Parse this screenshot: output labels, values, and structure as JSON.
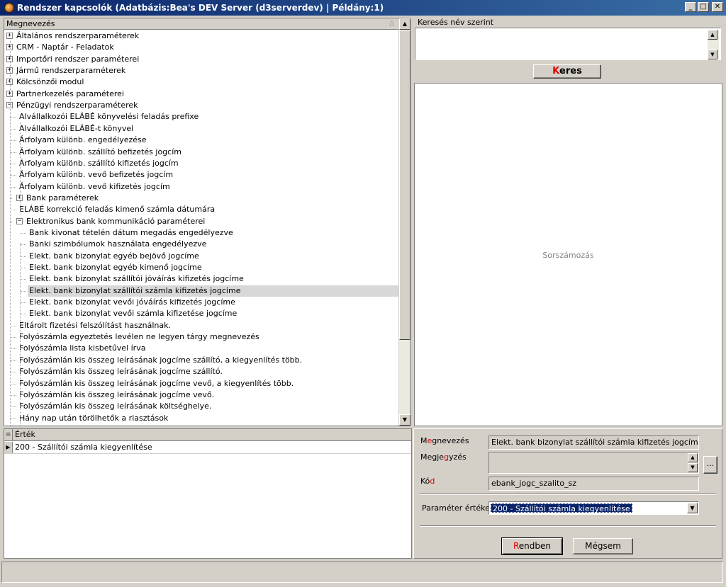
{
  "window": {
    "title": "Rendszer kapcsolók  (Adatbázis:Bea's DEV Server (d3serverdev) | Példány:1)",
    "minimize": "_",
    "maximize": "□",
    "close": "✕"
  },
  "tree": {
    "header": "Megnevezés",
    "rows": [
      {
        "label": "Általános rendszerparaméterek",
        "level": 0,
        "expander": "+"
      },
      {
        "label": "CRM - Naptár - Feladatok",
        "level": 0,
        "expander": "+"
      },
      {
        "label": "Importőri rendszer paraméterei",
        "level": 0,
        "expander": "+"
      },
      {
        "label": "Jármű rendszerparaméterek",
        "level": 0,
        "expander": "+"
      },
      {
        "label": "Kölcsönzői modul",
        "level": 0,
        "expander": "+"
      },
      {
        "label": "Partnerkezelés paraméterei",
        "level": 0,
        "expander": "+"
      },
      {
        "label": "Pénzügyi rendszerparaméterek",
        "level": 0,
        "expander": "−"
      },
      {
        "label": "Alvállalkozói ELÁBÉ könyvelési feladás prefixe",
        "level": 1
      },
      {
        "label": "Alvállalkozói ELÁBÉ-t könyvel",
        "level": 1
      },
      {
        "label": "Árfolyam különb. engedélyezése",
        "level": 1
      },
      {
        "label": "Árfolyam különb. szállító befizetés jogcím",
        "level": 1
      },
      {
        "label": "Árfolyam különb. szállító kifizetés jogcím",
        "level": 1
      },
      {
        "label": "Árfolyam különb. vevő befizetés jogcím",
        "level": 1
      },
      {
        "label": "Árfolyam különb. vevő kifizetés jogcím",
        "level": 1
      },
      {
        "label": "Bank paraméterek",
        "level": 1,
        "expander": "+"
      },
      {
        "label": "ELÁBÉ korrekció feladás kimenő számla dátumára",
        "level": 1
      },
      {
        "label": "Elektronikus bank kommunikáció paraméterei",
        "level": 1,
        "expander": "−"
      },
      {
        "label": "Bank kivonat tételén dátum megadás engedélyezve",
        "level": 2
      },
      {
        "label": "Banki szimbólumok használata engedélyezve",
        "level": 2
      },
      {
        "label": "Elekt. bank bizonylat egyéb bejövő jogcíme",
        "level": 2
      },
      {
        "label": "Elekt. bank bizonylat egyéb kimenő jogcíme",
        "level": 2
      },
      {
        "label": "Elekt. bank bizonylat szállítói jóváírás kifizetés jogcíme",
        "level": 2
      },
      {
        "label": "Elekt. bank bizonylat szállítói számla kifizetés jogcíme",
        "level": 2,
        "selected": true
      },
      {
        "label": "Elekt. bank bizonylat vevői jóváírás kifizetés jogcíme",
        "level": 2
      },
      {
        "label": "Elekt. bank bizonylat vevői számla kifizetése jogcíme",
        "level": 2
      },
      {
        "label": "Eltárolt fizetési felszólítást használnak.",
        "level": 1
      },
      {
        "label": "Folyószámla egyeztetés levélen ne legyen tárgy megnevezés",
        "level": 1
      },
      {
        "label": "Folyószámla lista kisbetűvel írva",
        "level": 1
      },
      {
        "label": "Folyószámlán kis összeg leírásának jogcíme szállító, a kiegyenlítés több.",
        "level": 1
      },
      {
        "label": "Folyószámlán kis összeg leírásának jogcíme szállító.",
        "level": 1
      },
      {
        "label": "Folyószámlán kis összeg leírásának jogcíme vevő, a kiegyenlítés több.",
        "level": 1
      },
      {
        "label": "Folyószámlán kis összeg leírásának jogcíme vevő.",
        "level": 1
      },
      {
        "label": "Folyószámlán kis összeg leírásának költséghelye.",
        "level": 1
      },
      {
        "label": "Hány nap után törölhetők a riasztások",
        "level": 1
      }
    ]
  },
  "values": {
    "header": "Érték",
    "rows": [
      "200 - Szállítói számla kiegyenlítése"
    ]
  },
  "search": {
    "legend": "Keresés név szerint",
    "value": "",
    "button_hotkey": "K",
    "button_rest": "eres"
  },
  "sorszamozas": "Sorszámozás",
  "details": {
    "name_label_a": "M",
    "name_label_b": "e",
    "name_label_c": "gnevezés",
    "name_value": "Elekt. bank bizonylat szállítói számla kifizetés jogcíme",
    "note_label_a": "Megje",
    "note_label_b": "g",
    "note_label_c": "yzés",
    "note_value": "",
    "code_label_a": "Kó",
    "code_label_b": "d",
    "code_value": "ebank_jogc_szalito_sz",
    "param_label": "Paraméter értéke",
    "param_value": "200 - Szállítói számla kiegyenlítése",
    "ellipsis": "..."
  },
  "buttons": {
    "ok_hotkey": "R",
    "ok_rest": "endben",
    "cancel": "Mégsem"
  }
}
